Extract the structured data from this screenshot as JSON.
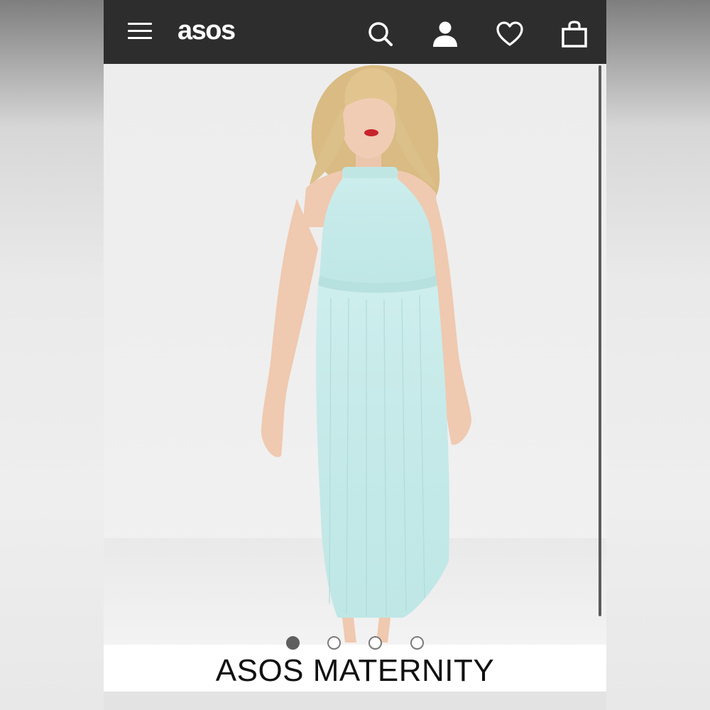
{
  "header": {
    "logo_text": "asos",
    "icons": [
      "menu-icon",
      "search-icon",
      "account-icon",
      "wishlist-icon",
      "bag-icon"
    ]
  },
  "product": {
    "brand": "ASOS MATERNITY",
    "image_count": 4,
    "active_image_index": 0
  },
  "colors": {
    "header_bg": "#2d2d2d",
    "dress": "#c9ecea",
    "page_bg": "#ededed"
  }
}
